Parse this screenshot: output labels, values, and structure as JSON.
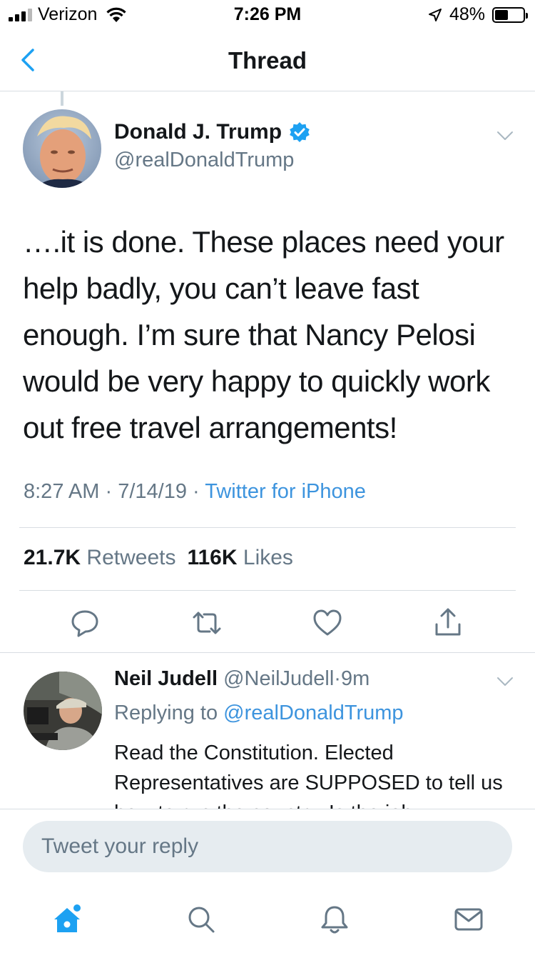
{
  "status_bar": {
    "carrier": "Verizon",
    "time": "7:26 PM",
    "battery_percent": "48%",
    "battery_level": 0.48
  },
  "nav": {
    "title": "Thread",
    "back_icon": "chevron-left-icon"
  },
  "tweet": {
    "author_name": "Donald J. Trump",
    "verified_icon": "verified-badge-icon",
    "author_handle": "@realDonaldTrump",
    "text": "….it is done. These places need your help badly, you can’t leave fast enough. I’m sure that Nancy Pelosi would be very happy to quickly work out free travel arrangements!",
    "time": "8:27 AM",
    "date": "7/14/19",
    "separator": "·",
    "source": "Twitter for iPhone",
    "retweets_count": "21.7K",
    "retweets_label": "Retweets",
    "likes_count": "116K",
    "likes_label": "Likes"
  },
  "actions": [
    "reply-icon",
    "retweet-icon",
    "like-icon",
    "share-icon"
  ],
  "reply": {
    "author_name": "Neil Judell",
    "author_handle": "@NeilJudell",
    "separator": "·",
    "age": "9m",
    "replying_label": "Replying to",
    "replying_to": "@realDonaldTrump",
    "text": "Read the Constitution. Elected Representatives are SUPPOSED to tell us how to run the country. Is the job"
  },
  "composer": {
    "placeholder": "Tweet your reply"
  },
  "tabs": [
    "home-icon",
    "search-icon",
    "notifications-icon",
    "messages-icon"
  ],
  "colors": {
    "accent": "#1da1f2",
    "link": "#3d94de",
    "secondary_text": "#657786",
    "divider": "#d8dde2"
  }
}
